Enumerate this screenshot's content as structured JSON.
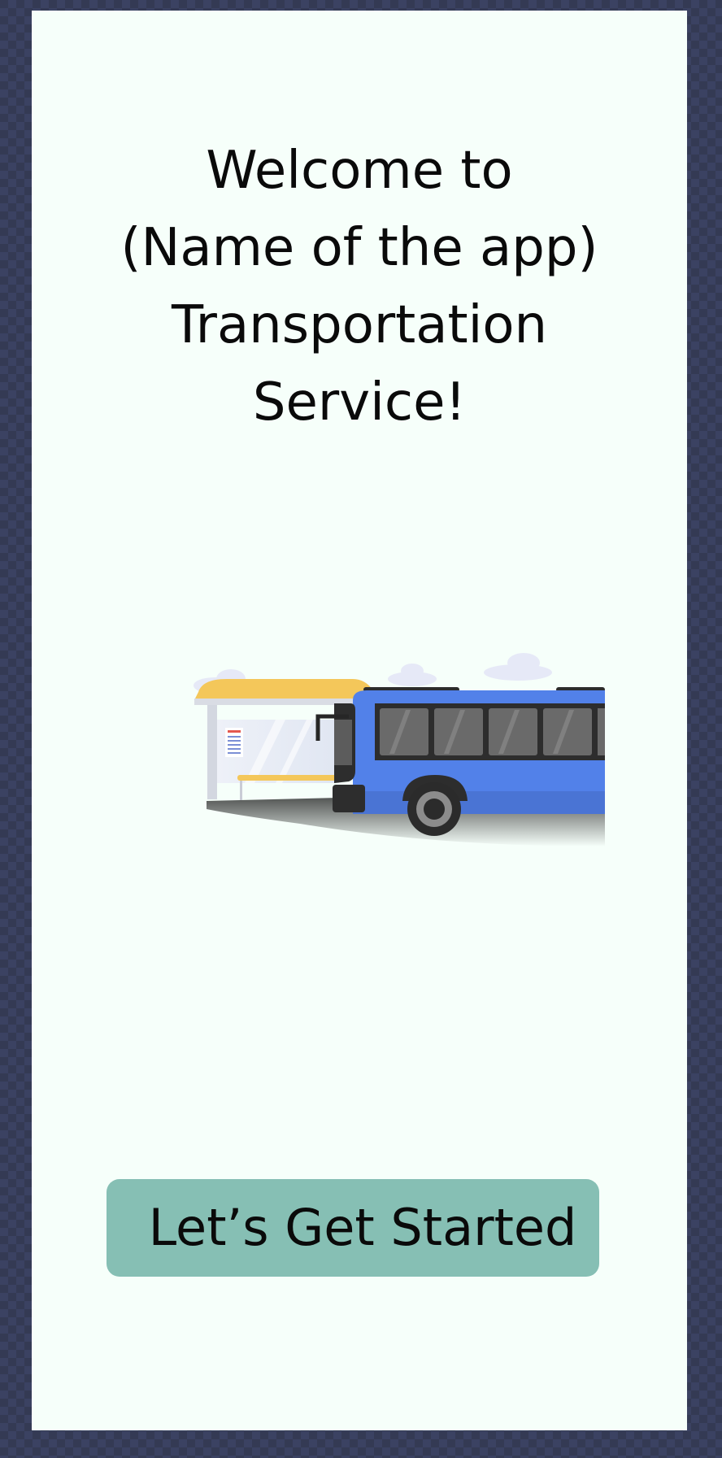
{
  "welcome": {
    "line1": "Welcome to",
    "line2": "(Name of the app)",
    "line3": "Transportation",
    "line4": "Service!"
  },
  "cta": {
    "label": "Let’s Get Started"
  },
  "colors": {
    "screen_background": "#f6fffa",
    "outer_background": "#343a54",
    "button": "#86bfb4",
    "bus_body": "#5281e9",
    "shelter_roof": "#f4c75a",
    "text": "#0a0a0a"
  }
}
